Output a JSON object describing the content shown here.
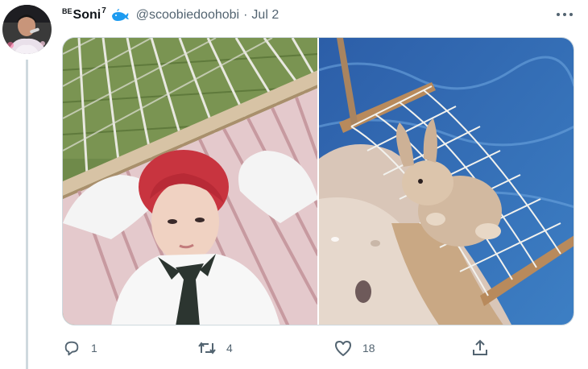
{
  "tweet": {
    "author": {
      "name_prefix": "BE",
      "name": "Soni",
      "name_suffix": "7",
      "handle": "@scoobiedoohobi",
      "avatar_icon": "avatar-photo",
      "badge_icon": "whale-icon"
    },
    "separator": "·",
    "date": "Jul 2",
    "more_icon": "more-icon",
    "media": [
      {
        "icon": "photo-person-hammock"
      },
      {
        "icon": "photo-bunny-hammock"
      }
    ],
    "actions": {
      "reply": {
        "icon": "reply-icon",
        "count": "1"
      },
      "retweet": {
        "icon": "retweet-icon",
        "count": "4"
      },
      "like": {
        "icon": "heart-icon",
        "count": "18"
      },
      "share": {
        "icon": "share-icon"
      }
    },
    "colors": {
      "text_primary": "#0f1419",
      "text_secondary": "#536471",
      "border": "#cfd9de",
      "whale_blue": "#1d9bf0",
      "pool_blue": "#2d6fb3"
    }
  }
}
